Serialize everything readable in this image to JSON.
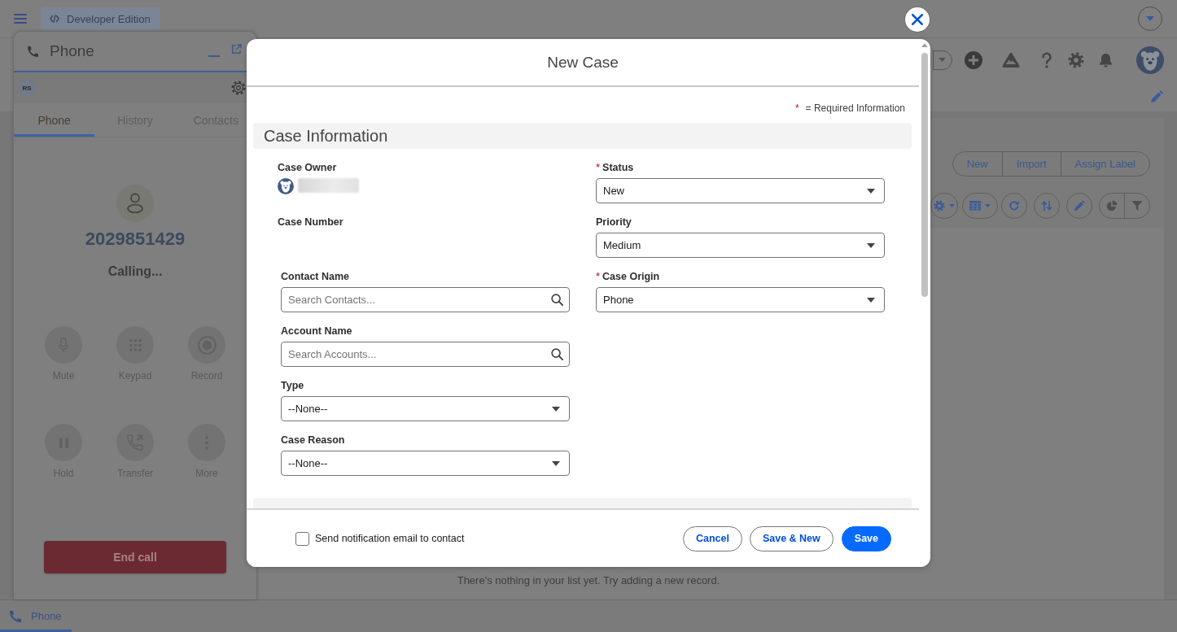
{
  "top_bar": {
    "badge": "Developer Edition"
  },
  "phone_panel": {
    "title": "Phone",
    "initials": "RS",
    "tabs": [
      {
        "label": "Phone",
        "selected": true
      },
      {
        "label": "History",
        "selected": false
      },
      {
        "label": "Contacts",
        "selected": false
      }
    ],
    "number": "2029851429",
    "status": "Calling...",
    "actions": [
      {
        "kind": "mute",
        "label": "Mute"
      },
      {
        "kind": "keypad",
        "label": "Keypad"
      },
      {
        "kind": "record",
        "label": "Record"
      },
      {
        "kind": "hold",
        "label": "Hold"
      },
      {
        "kind": "transfer",
        "label": "Transfer"
      },
      {
        "kind": "more",
        "label": "More"
      }
    ],
    "end_call": "End call"
  },
  "list_view": {
    "buttons": [
      "New",
      "Import",
      "Assign Label"
    ],
    "empty_message": "There's nothing in your list yet. Try adding a new record."
  },
  "modal": {
    "title": "New Case",
    "required_legend": {
      "mark": "*",
      "text": "= Required Information"
    },
    "sections": [
      {
        "title": "Case Information",
        "rows": [
          [
            {
              "kind": "owner",
              "label": "Case Owner"
            },
            {
              "kind": "picklist",
              "label": "Status",
              "required_mark": "*",
              "value": "New"
            }
          ],
          [
            {
              "kind": "output",
              "label": "Case Number"
            },
            {
              "kind": "picklist",
              "label": "Priority",
              "value": "Medium"
            }
          ],
          [
            {
              "kind": "lookup",
              "label": "Contact Name",
              "placeholder": "Search Contacts..."
            },
            {
              "kind": "picklist",
              "label": "Case Origin",
              "required_mark": "*",
              "value": "Phone"
            }
          ],
          [
            {
              "kind": "lookup",
              "label": "Account Name",
              "placeholder": "Search Accounts..."
            }
          ],
          [
            {
              "kind": "picklist",
              "label": "Type",
              "value": "--None--"
            }
          ],
          [
            {
              "kind": "picklist",
              "label": "Case Reason",
              "value": "--None--"
            }
          ]
        ]
      }
    ],
    "footer": {
      "checkbox": {
        "label": "Send notification email to contact",
        "checked": false
      },
      "buttons": [
        {
          "kind": "neutral",
          "label": "Cancel"
        },
        {
          "kind": "neutral",
          "label": "Save & New"
        },
        {
          "kind": "brand",
          "label": "Save"
        }
      ]
    }
  },
  "utility_bar": {
    "items": [
      {
        "label": "Phone",
        "selected": true
      }
    ]
  }
}
